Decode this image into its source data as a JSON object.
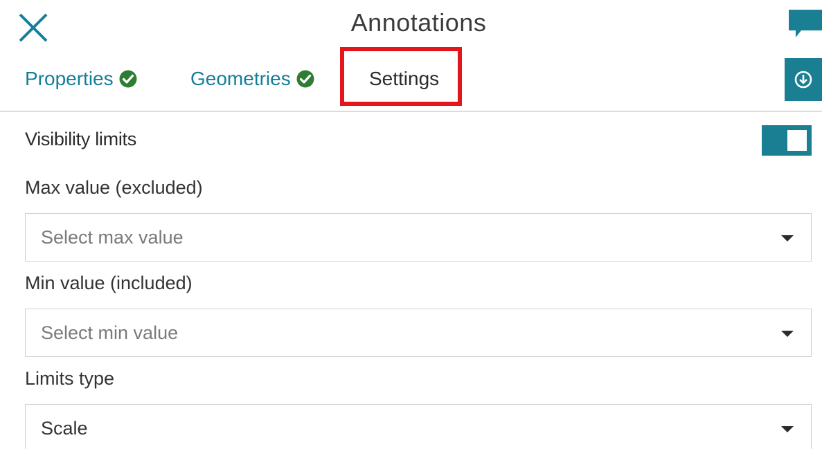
{
  "header": {
    "title": "Annotations"
  },
  "tabs": [
    {
      "label": "Properties",
      "complete": true
    },
    {
      "label": "Geometries",
      "complete": true
    },
    {
      "label": "Settings",
      "complete": false,
      "active": true
    }
  ],
  "settings": {
    "section_label": "Visibility limits",
    "visibility_toggle_on": true,
    "max_field": {
      "label": "Max value (excluded)",
      "placeholder": "Select max value"
    },
    "min_field": {
      "label": "Min value (included)",
      "placeholder": "Select min value"
    },
    "limits_type": {
      "label": "Limits type",
      "value": "Scale"
    }
  },
  "colors": {
    "accent": "#1b7f93",
    "tab_text": "#157e98",
    "check": "#2e7d32",
    "highlight": "#e3161c"
  },
  "icons": {
    "close": "close-icon",
    "comment": "comment-icon",
    "check": "check-circle-icon",
    "download": "download-circle-icon",
    "dropdown": "caret-down-icon"
  }
}
